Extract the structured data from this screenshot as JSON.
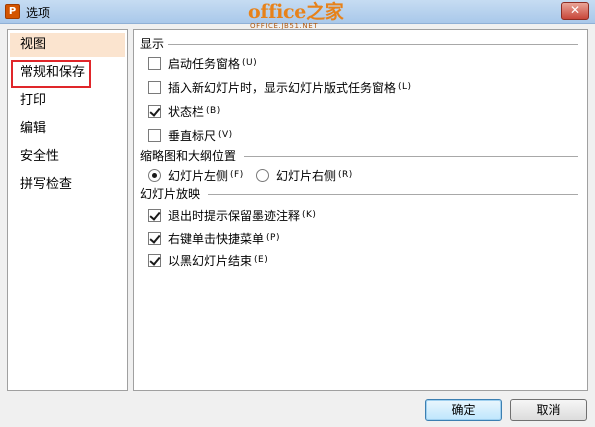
{
  "window": {
    "title": "选项",
    "app_icon_label": "P",
    "close_label": "✕"
  },
  "watermark": {
    "main": "office之家",
    "sub": "OFFICE.JB51.NET"
  },
  "sidebar": {
    "items": [
      {
        "label": "视图"
      },
      {
        "label": "常规和保存"
      },
      {
        "label": "打印"
      },
      {
        "label": "编辑"
      },
      {
        "label": "安全性"
      },
      {
        "label": "拼写检查"
      }
    ],
    "selected_index": 0
  },
  "sections": [
    {
      "heading": "显示",
      "options": [
        {
          "type": "checkbox",
          "label": "启动任务窗格",
          "hotkey": "(U)",
          "checked": false
        },
        {
          "type": "checkbox",
          "label": "插入新幻灯片时，显示幻灯片版式任务窗格",
          "hotkey": "(L)",
          "checked": false
        },
        {
          "type": "checkbox",
          "label": "状态栏",
          "hotkey": "(B)",
          "checked": true
        },
        {
          "type": "checkbox",
          "label": "垂直标尺",
          "hotkey": "(V)",
          "checked": false
        }
      ]
    },
    {
      "heading": "缩略图和大纲位置",
      "options": [
        {
          "type": "radio",
          "label": "幻灯片左侧",
          "hotkey": "(F)",
          "checked": true
        },
        {
          "type": "radio",
          "label": "幻灯片右侧",
          "hotkey": "(R)",
          "checked": false
        }
      ]
    },
    {
      "heading": "幻灯片放映",
      "options": [
        {
          "type": "checkbox",
          "label": "退出时提示保留墨迹注释",
          "hotkey": "(K)",
          "checked": true
        },
        {
          "type": "checkbox",
          "label": "右键单击快捷菜单",
          "hotkey": "(P)",
          "checked": true
        },
        {
          "type": "checkbox",
          "label": "以黑幻灯片结束",
          "hotkey": "(E)",
          "checked": true
        }
      ]
    }
  ],
  "buttons": {
    "ok": "确定",
    "cancel": "取消"
  },
  "colors": {
    "selected_nav_bg": "#fbe4cf",
    "highlight_border": "#e0262a",
    "watermark": "#e7821a"
  }
}
